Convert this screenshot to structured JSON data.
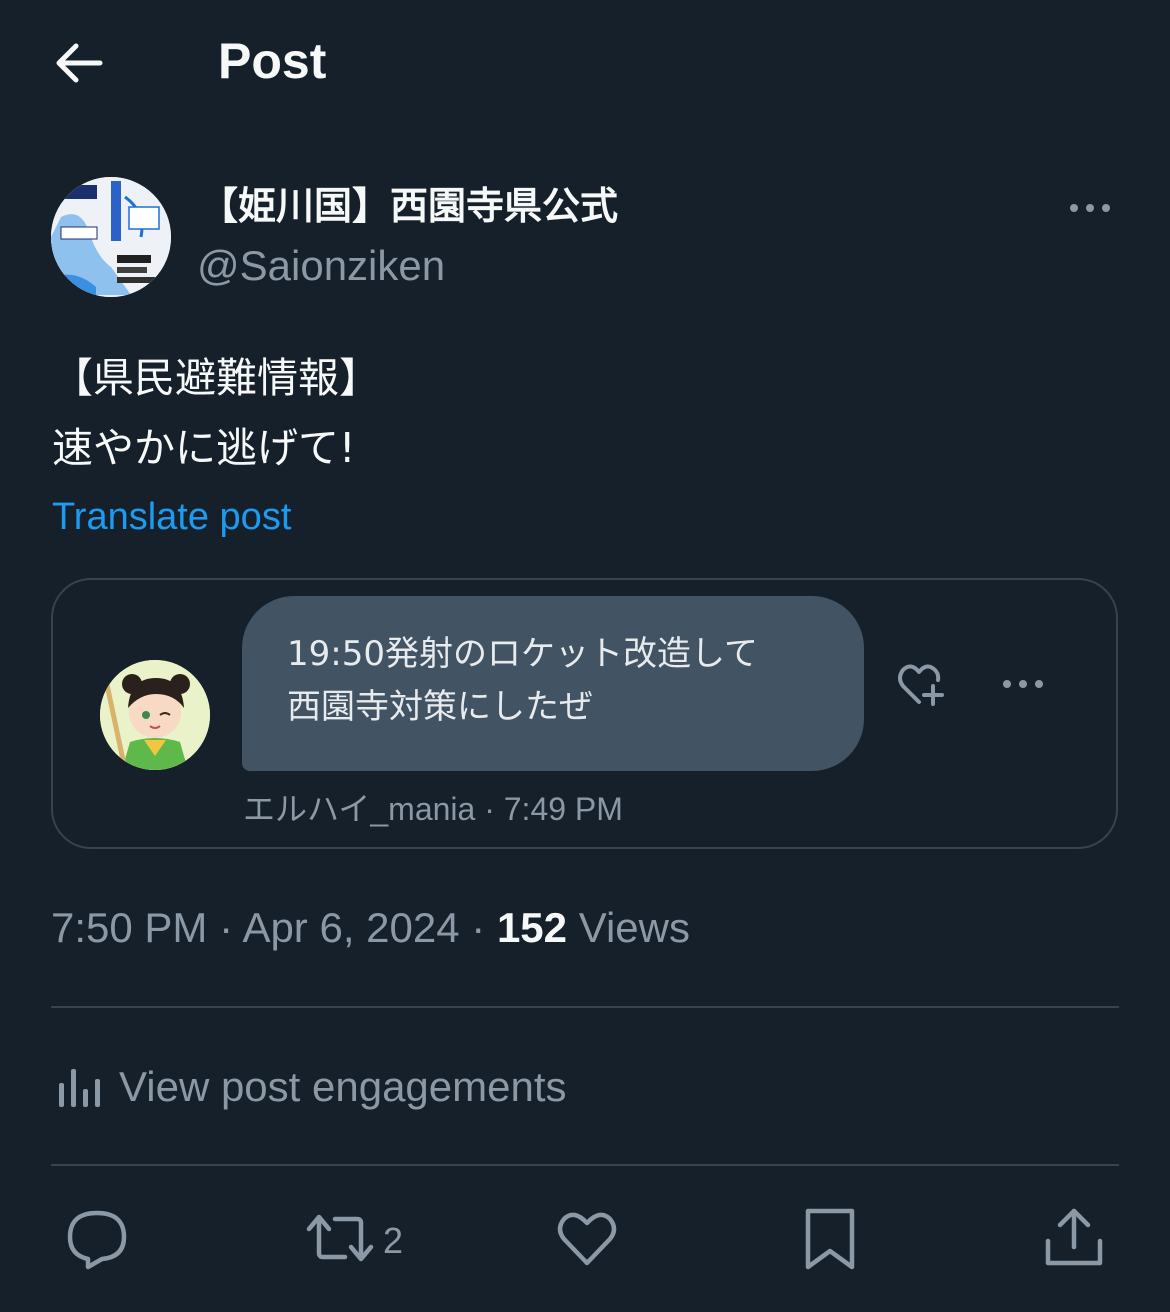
{
  "header": {
    "title": "Post"
  },
  "author": {
    "display_name": "【姫川国】西園寺県公式",
    "handle": "@Saionziken"
  },
  "post": {
    "lines": [
      "【県民避難情報】",
      "速やかに逃げて!"
    ],
    "translate_label": "Translate post"
  },
  "embed": {
    "message_lines": [
      "19:50発射のロケット改造して",
      "西園寺対策にしたぜ"
    ],
    "meta": "エルハイ_mania · 7:49 PM"
  },
  "meta": {
    "time": "7:50 PM",
    "date": "Apr 6, 2024",
    "separator": " · ",
    "views_count": "152",
    "views_label": "Views"
  },
  "engagements_label": "View post engagements",
  "actions": {
    "retweet_count": "2"
  },
  "colors": {
    "background": "#15202b",
    "text": "#f7f9f9",
    "secondary": "#8b98a5",
    "accent": "#1d9bf0",
    "border": "#38444d",
    "bubble": "#425363"
  }
}
